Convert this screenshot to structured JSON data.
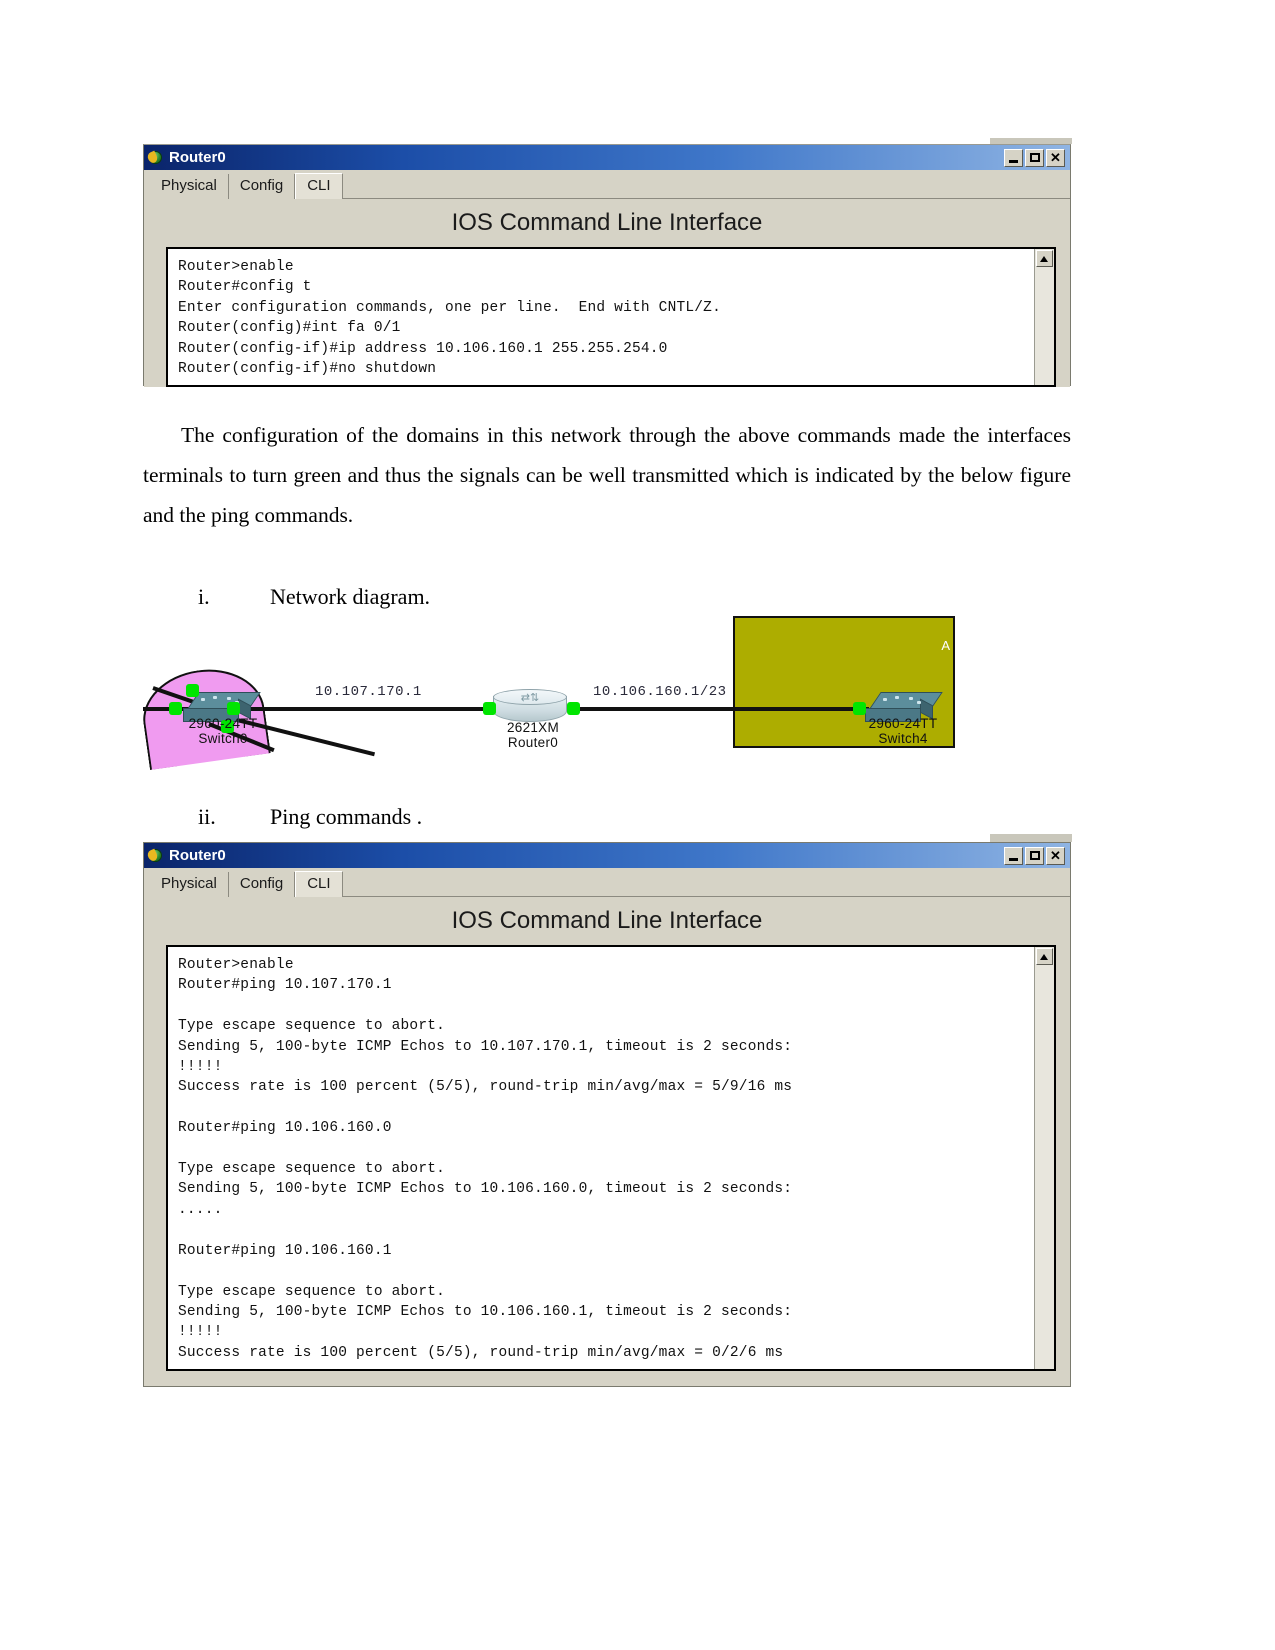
{
  "document": {
    "paragraph": "The configuration of the domains in this network through the above commands made the interfaces terminals to turn green and thus the signals can be well transmitted which is indicated by the below figure and the ping commands.",
    "list_items": [
      {
        "num": "i.",
        "text": "Network diagram."
      },
      {
        "num": "ii.",
        "text": "Ping commands ."
      }
    ]
  },
  "window_top": {
    "title": "Router0",
    "icon": "packet-tracer-globe-icon",
    "buttons": {
      "minimize": "–",
      "maximize": "□",
      "close": "✕"
    },
    "tabs": [
      {
        "label": "Physical",
        "active": false
      },
      {
        "label": "Config",
        "active": false
      },
      {
        "label": "CLI",
        "active": true
      }
    ],
    "heading": "IOS Command Line Interface",
    "console_text": "Router>enable\nRouter#config t\nEnter configuration commands, one per line.  End with CNTL/Z.\nRouter(config)#int fa 0/1\nRouter(config-if)#ip address 10.106.160.1 255.255.254.0\nRouter(config-if)#no shutdown"
  },
  "window_bottom": {
    "title": "Router0",
    "icon": "packet-tracer-globe-icon",
    "buttons": {
      "minimize": "–",
      "maximize": "□",
      "close": "✕"
    },
    "tabs": [
      {
        "label": "Physical",
        "active": false
      },
      {
        "label": "Config",
        "active": false
      },
      {
        "label": "CLI",
        "active": true
      }
    ],
    "heading": "IOS Command Line Interface",
    "console_text": "Router>enable\nRouter#ping 10.107.170.1\n\nType escape sequence to abort.\nSending 5, 100-byte ICMP Echos to 10.107.170.1, timeout is 2 seconds:\n!!!!!\nSuccess rate is 100 percent (5/5), round-trip min/avg/max = 5/9/16 ms\n\nRouter#ping 10.106.160.0\n\nType escape sequence to abort.\nSending 5, 100-byte ICMP Echos to 10.106.160.0, timeout is 2 seconds:\n.....\n\nRouter#ping 10.106.160.1\n\nType escape sequence to abort.\nSending 5, 100-byte ICMP Echos to 10.106.160.1, timeout is 2 seconds:\n!!!!!\nSuccess rate is 100 percent (5/5), round-trip min/avg/max = 0/2/6 ms"
  },
  "diagram": {
    "link_labels": [
      {
        "text": "10.107.170.1"
      },
      {
        "text": "10.106.160.1/23"
      }
    ],
    "devices": [
      {
        "model": "2960-24TT",
        "name": "Switch0",
        "kind": "switch"
      },
      {
        "model": "2621XM",
        "name": "Router0",
        "kind": "router"
      },
      {
        "model": "2960-24TT",
        "name": "Switch4",
        "kind": "switch"
      }
    ],
    "zones": [
      {
        "name": "pink-cloud-zone",
        "color": "#f09bf0"
      },
      {
        "name": "olive-rect-zone",
        "color": "#adad00",
        "label": "A"
      }
    ],
    "link_status_color": "#00e500"
  }
}
